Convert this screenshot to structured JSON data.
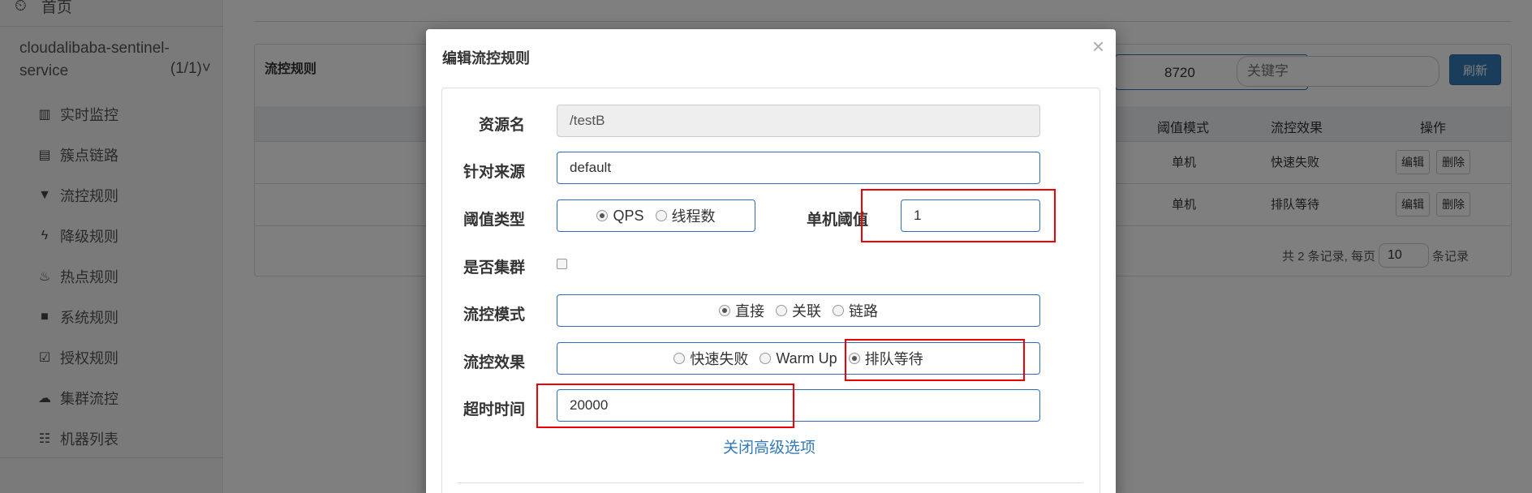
{
  "sidebar": {
    "home_label": "首页",
    "app_name": "cloudalibaba-sentinel-service",
    "app_count": "(1/1)",
    "items": [
      {
        "label": "实时监控",
        "icon": "bar-chart-icon"
      },
      {
        "label": "簇点链路",
        "icon": "list-alt-icon"
      },
      {
        "label": "流控规则",
        "icon": "filter-icon"
      },
      {
        "label": "降级规则",
        "icon": "flash-icon"
      },
      {
        "label": "热点规则",
        "icon": "fire-icon"
      },
      {
        "label": "系统规则",
        "icon": "lock-icon"
      },
      {
        "label": "授权规则",
        "icon": "check-icon"
      },
      {
        "label": "集群流控",
        "icon": "cloud-icon"
      },
      {
        "label": "机器列表",
        "icon": "th-list-icon"
      }
    ]
  },
  "panel": {
    "title": "流控规则",
    "machine_value": "8720",
    "keyword_placeholder": "关键字",
    "refresh_label": "刷新",
    "columns": [
      "阈值模式",
      "流控效果",
      "操作"
    ],
    "rows": [
      {
        "mode": "单机",
        "effect": "快速失败",
        "edit": "编辑",
        "delete": "删除"
      },
      {
        "mode": "单机",
        "effect": "排队等待",
        "edit": "编辑",
        "delete": "删除"
      }
    ],
    "pager_prefix": "共 2 条记录, 每页",
    "page_size": "10",
    "pager_suffix": "条记录"
  },
  "modal": {
    "title": "编辑流控规则",
    "close": "×",
    "resource_label": "资源名",
    "resource_value": "/testB",
    "origin_label": "针对来源",
    "origin_value": "default",
    "threshold_type_label": "阈值类型",
    "threshold_type_options": [
      "QPS",
      "线程数"
    ],
    "threshold_type_selected": "QPS",
    "single_threshold_label": "单机阈值",
    "single_threshold_value": "1",
    "cluster_label": "是否集群",
    "cluster_checked": false,
    "mode_label": "流控模式",
    "mode_options": [
      "直接",
      "关联",
      "链路"
    ],
    "mode_selected": "直接",
    "effect_label": "流控效果",
    "effect_options": [
      "快速失败",
      "Warm Up",
      "排队等待"
    ],
    "effect_selected": "排队等待",
    "timeout_label": "超时时间",
    "timeout_value": "20000",
    "advanced_link": "关闭高级选项"
  },
  "colors": {
    "primary": "#337ab7",
    "highlight": "#e00000",
    "overlay": "rgba(0,0,0,0.5)"
  }
}
